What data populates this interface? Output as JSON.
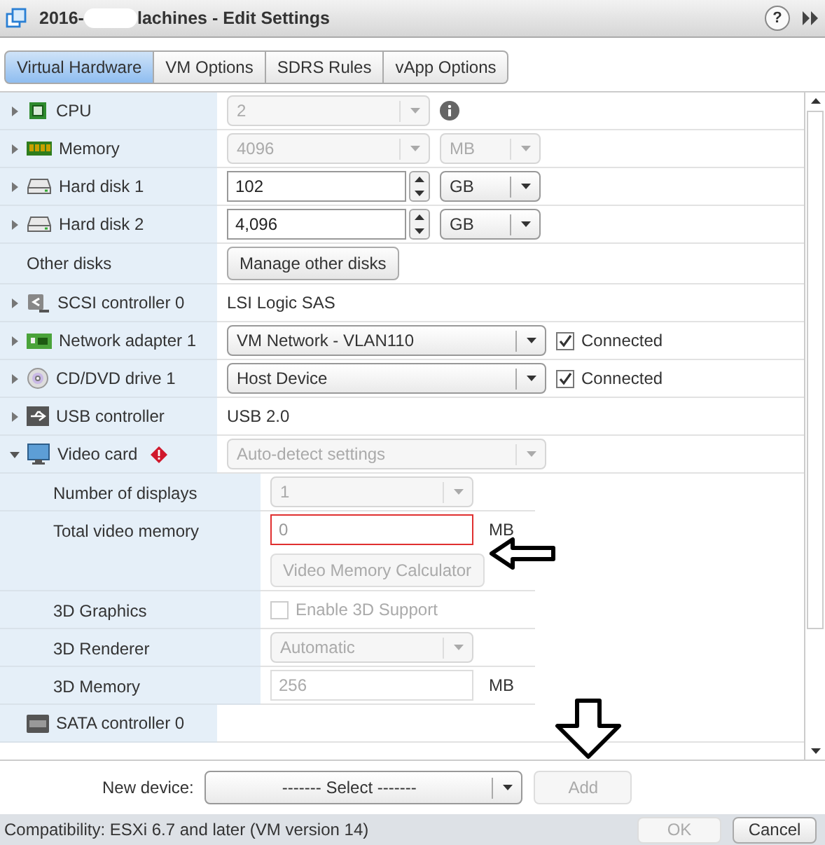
{
  "window": {
    "title_start": "2016-",
    "title_end": "lachines - Edit Settings",
    "help": "?"
  },
  "tabs": [
    {
      "label": "Virtual Hardware",
      "selected": true
    },
    {
      "label": "VM Options",
      "selected": false
    },
    {
      "label": "SDRS Rules",
      "selected": false
    },
    {
      "label": "vApp Options",
      "selected": false
    }
  ],
  "devices": [
    {
      "label": "CPU",
      "kind": "cpu",
      "expanded": false,
      "controls": [
        {
          "kind": "select",
          "value": "2",
          "disabled": true
        },
        {
          "kind": "info"
        }
      ]
    },
    {
      "label": "Memory",
      "kind": "memory",
      "expanded": false,
      "controls": [
        {
          "kind": "select",
          "value": "4096",
          "disabled": true
        },
        {
          "kind": "unit_select",
          "value": "MB",
          "disabled": true
        }
      ]
    },
    {
      "label": "Hard disk 1",
      "kind": "disk",
      "expanded": false,
      "controls": [
        {
          "kind": "spin",
          "value": "102"
        },
        {
          "kind": "unit_select",
          "value": "GB",
          "disabled": false
        }
      ]
    },
    {
      "label": "Hard disk 2",
      "kind": "disk",
      "expanded": false,
      "controls": [
        {
          "kind": "spin",
          "value": "4,096"
        },
        {
          "kind": "unit_select",
          "value": "GB",
          "disabled": false
        }
      ]
    },
    {
      "label": "Other disks",
      "controls": [
        {
          "kind": "button",
          "label": "Manage other disks",
          "disabled": false
        }
      ]
    },
    {
      "label": "SCSI controller 0",
      "kind": "scsi",
      "expanded": false,
      "controls": [
        {
          "kind": "text",
          "value": "LSI Logic SAS"
        }
      ]
    },
    {
      "label": "Network adapter 1",
      "kind": "network",
      "expanded": false,
      "controls": [
        {
          "kind": "wide_select",
          "value": "VM Network - VLAN110",
          "disabled": false
        },
        {
          "kind": "checkbox",
          "label": "Connected",
          "checked": true,
          "disabled": false
        }
      ]
    },
    {
      "label": "CD/DVD drive 1",
      "kind": "cd",
      "expanded": false,
      "controls": [
        {
          "kind": "wide_select",
          "value": "Host Device",
          "disabled": false
        },
        {
          "kind": "checkbox",
          "label": "Connected",
          "checked": true,
          "disabled": false
        }
      ]
    },
    {
      "label": "USB controller",
      "kind": "usb",
      "expanded": false,
      "controls": [
        {
          "kind": "text",
          "value": "USB 2.0"
        }
      ]
    },
    {
      "label": "Video card",
      "kind": "monitor",
      "warning": true,
      "expanded": true,
      "controls": [
        {
          "kind": "wide_select",
          "value": "Auto-detect settings",
          "disabled": true
        }
      ],
      "children": [
        {
          "label": "Number of displays",
          "controls": [
            {
              "kind": "select",
              "value": "1",
              "disabled": true
            }
          ]
        },
        {
          "label": "Total video memory",
          "controls": [
            {
              "kind": "input",
              "value": "0",
              "disabled": false,
              "error": true
            },
            {
              "kind": "unit_text",
              "value": "MB"
            }
          ],
          "below": [
            {
              "kind": "button",
              "label": "Video Memory Calculator",
              "disabled": true
            }
          ]
        },
        {
          "label": "3D Graphics",
          "controls": [
            {
              "kind": "checkbox",
              "label": "Enable 3D Support",
              "checked": false,
              "disabled": true
            }
          ]
        },
        {
          "label": "3D Renderer",
          "controls": [
            {
              "kind": "select",
              "value": "Automatic",
              "disabled": true
            }
          ]
        },
        {
          "label": "3D Memory",
          "controls": [
            {
              "kind": "input",
              "value": "256",
              "disabled": true
            },
            {
              "kind": "unit_text",
              "value": "MB"
            }
          ]
        }
      ]
    },
    {
      "label": "SATA controller 0",
      "kind": "sata"
    }
  ],
  "new_device": {
    "label": "New device:",
    "select": "------- Select -------",
    "button": {
      "label": "Add",
      "disabled": true
    }
  },
  "status": "Compatibility: ESXi 6.7 and later (VM version 14)",
  "buttons": [
    {
      "label": "OK",
      "disabled": true
    },
    {
      "label": "Cancel",
      "disabled": false
    }
  ]
}
